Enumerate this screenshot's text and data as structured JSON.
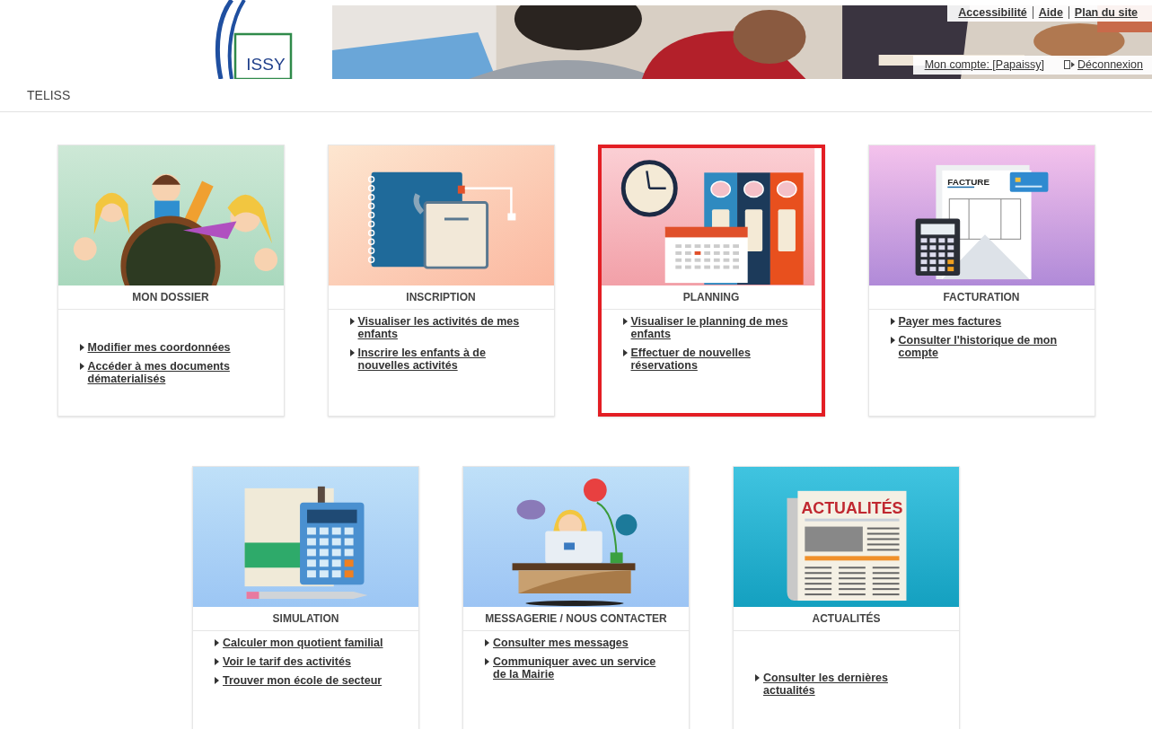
{
  "header": {
    "logo_text": "ISSY",
    "top_links": [
      "Accessibilité",
      "Aide",
      "Plan du site"
    ],
    "account_link": "Mon compte: [Papaissy]",
    "logout_link": "Déconnexion"
  },
  "breadcrumb": "TELISS",
  "cards": [
    {
      "kind": "children",
      "title": "MON DOSSIER",
      "selected": false,
      "links_centered": true,
      "links": [
        "Modifier mes coordonnées",
        "Accéder à mes documents dématerialisés"
      ]
    },
    {
      "kind": "notebook",
      "title": "INSCRIPTION",
      "selected": false,
      "links_centered": false,
      "links": [
        "Visualiser les activités de mes enfants",
        "Inscrire les enfants à de nouvelles activités"
      ]
    },
    {
      "kind": "planning",
      "title": "PLANNING",
      "selected": true,
      "links_centered": false,
      "links": [
        "Visualiser le planning de mes enfants",
        "Effectuer de nouvelles réservations"
      ]
    },
    {
      "kind": "invoice",
      "title": "FACTURATION",
      "selected": false,
      "links_centered": false,
      "illustration_text": "FACTURE",
      "links": [
        "Payer mes factures",
        "Consulter l'historique de mon compte"
      ]
    },
    {
      "kind": "calculator",
      "title": "SIMULATION",
      "selected": false,
      "links_centered": false,
      "links": [
        "Calculer mon quotient familial",
        "Voir le tarif des activités",
        "Trouver mon école de secteur"
      ]
    },
    {
      "kind": "messaging",
      "title": "MESSAGERIE / NOUS CONTACTER",
      "selected": false,
      "links_centered": false,
      "links": [
        "Consulter mes messages",
        "Communiquer avec un service de la Mairie"
      ]
    },
    {
      "kind": "news",
      "title": "ACTUALITÉS",
      "selected": false,
      "links_centered": true,
      "illustration_text": "ACTUALITÉS",
      "links": [
        "Consulter les dernières actualités"
      ]
    }
  ]
}
